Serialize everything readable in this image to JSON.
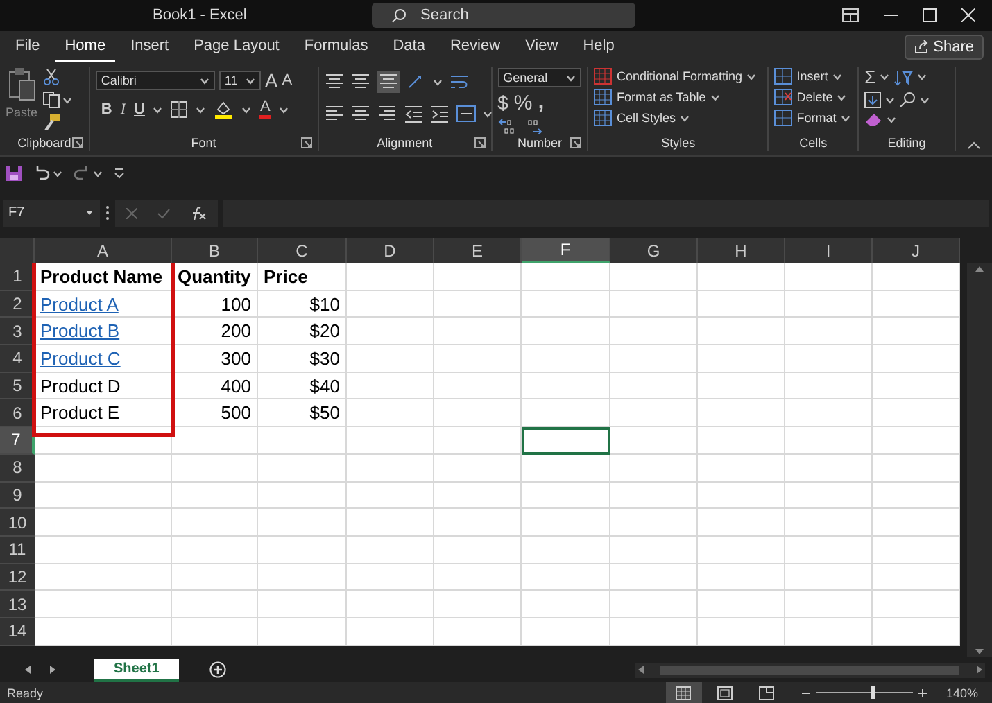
{
  "window": {
    "title": "Book1 - Excel"
  },
  "search": {
    "placeholder": "Search"
  },
  "menu_tabs": [
    {
      "label": "File",
      "selected": false
    },
    {
      "label": "Home",
      "selected": true
    },
    {
      "label": "Insert",
      "selected": false
    },
    {
      "label": "Page Layout",
      "selected": false
    },
    {
      "label": "Formulas",
      "selected": false
    },
    {
      "label": "Data",
      "selected": false
    },
    {
      "label": "Review",
      "selected": false
    },
    {
      "label": "View",
      "selected": false
    },
    {
      "label": "Help",
      "selected": false
    }
  ],
  "share_button": {
    "label": "Share"
  },
  "ribbon": {
    "clipboard": {
      "label": "Clipboard",
      "paste": "Paste"
    },
    "font": {
      "label": "Font",
      "name": "Calibri",
      "size": "11",
      "size_buttons": [
        {
          "kind": "grow",
          "label": "A"
        },
        {
          "kind": "shrink",
          "label": "A"
        }
      ],
      "format_buttons": [
        {
          "kind": "bold",
          "label": "B"
        },
        {
          "kind": "italic",
          "label": "I"
        },
        {
          "kind": "underline",
          "label": "U"
        }
      ],
      "font_color": "A"
    },
    "alignment": {
      "label": "Alignment"
    },
    "number": {
      "label": "Number",
      "format": "General",
      "buttons": [
        {
          "kind": "currency",
          "label": "$"
        },
        {
          "kind": "percent",
          "label": "%"
        },
        {
          "kind": "comma",
          "label": ","
        }
      ]
    },
    "styles": {
      "label": "Styles",
      "commands": [
        "Conditional Formatting",
        "Format as Table",
        "Cell Styles"
      ]
    },
    "cells": {
      "label": "Cells",
      "commands": [
        "Insert",
        "Delete",
        "Format"
      ]
    },
    "editing": {
      "label": "Editing",
      "autosum": "Σ"
    }
  },
  "name_box": {
    "value": "F7"
  },
  "columns": [
    {
      "label": "A",
      "selected": false
    },
    {
      "label": "B",
      "selected": false
    },
    {
      "label": "C",
      "selected": false
    },
    {
      "label": "D",
      "selected": false
    },
    {
      "label": "E",
      "selected": false
    },
    {
      "label": "F",
      "selected": true
    },
    {
      "label": "G",
      "selected": false
    },
    {
      "label": "H",
      "selected": false
    },
    {
      "label": "I",
      "selected": false
    },
    {
      "label": "J",
      "selected": false
    }
  ],
  "rows": [
    {
      "label": "1",
      "selected": false,
      "cells": [
        {
          "kind": "header",
          "text": "Product Name"
        },
        {
          "kind": "header",
          "text": "Quantity"
        },
        {
          "kind": "header",
          "text": "Price"
        }
      ]
    },
    {
      "label": "2",
      "selected": false,
      "cells": [
        {
          "kind": "link",
          "text": "Product A"
        },
        {
          "kind": "number",
          "text": "100"
        },
        {
          "kind": "number",
          "text": "$10"
        }
      ]
    },
    {
      "label": "3",
      "selected": false,
      "cells": [
        {
          "kind": "link",
          "text": "Product B"
        },
        {
          "kind": "number",
          "text": "200"
        },
        {
          "kind": "number",
          "text": "$20"
        }
      ]
    },
    {
      "label": "4",
      "selected": false,
      "cells": [
        {
          "kind": "link",
          "text": "Product C"
        },
        {
          "kind": "number",
          "text": "300"
        },
        {
          "kind": "number",
          "text": "$30"
        }
      ]
    },
    {
      "label": "5",
      "selected": false,
      "cells": [
        {
          "kind": "text",
          "text": "Product D"
        },
        {
          "kind": "number",
          "text": "400"
        },
        {
          "kind": "number",
          "text": "$40"
        }
      ]
    },
    {
      "label": "6",
      "selected": false,
      "cells": [
        {
          "kind": "text",
          "text": "Product E"
        },
        {
          "kind": "number",
          "text": "500"
        },
        {
          "kind": "number",
          "text": "$50"
        }
      ]
    },
    {
      "label": "7",
      "selected": true
    },
    {
      "label": "8",
      "selected": false
    },
    {
      "label": "9",
      "selected": false
    },
    {
      "label": "10",
      "selected": false
    },
    {
      "label": "11",
      "selected": false
    },
    {
      "label": "12",
      "selected": false
    },
    {
      "label": "13",
      "selected": false
    },
    {
      "label": "14",
      "selected": false
    }
  ],
  "sheet_tabs": [
    {
      "label": "Sheet1",
      "selected": true
    }
  ],
  "status_bar": {
    "status": "Ready",
    "views": [
      {
        "kind": "normal",
        "selected": true
      },
      {
        "kind": "page_layout",
        "selected": false
      },
      {
        "kind": "page_break",
        "selected": false
      }
    ],
    "zoom": {
      "level": 0.58,
      "reading": "140%"
    }
  }
}
